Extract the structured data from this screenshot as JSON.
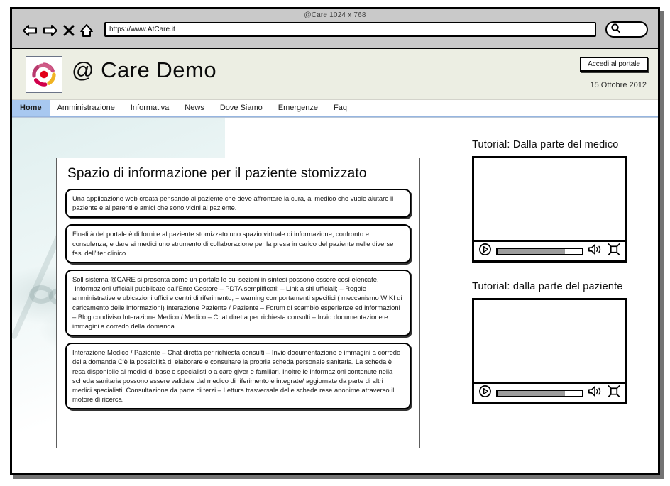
{
  "window": {
    "title": "@Care 1024 x 768"
  },
  "browser": {
    "url": "https://www.AtCare.it",
    "url_placeholder": "https://",
    "back_icon": "back-arrow-icon",
    "forward_icon": "forward-arrow-icon",
    "stop_icon": "stop-x-icon",
    "home_icon": "home-icon",
    "search_icon": "search-icon",
    "search_value": ""
  },
  "site": {
    "title": "@ Care Demo",
    "logo_icon": "at-care-swirl-logo",
    "login_button": "Accedi al portale",
    "date": "15 Ottobre 2012"
  },
  "nav": {
    "items": [
      {
        "label": "Home",
        "active": true
      },
      {
        "label": "Amministrazione",
        "active": false
      },
      {
        "label": "Informativa",
        "active": false
      },
      {
        "label": "News",
        "active": false
      },
      {
        "label": "Dove Siamo",
        "active": false
      },
      {
        "label": "Emergenze",
        "active": false
      },
      {
        "label": "Faq",
        "active": false
      }
    ]
  },
  "article": {
    "heading": "Spazio di informazione per il paziente stomizzato",
    "boxes": [
      "Una applicazione web creata pensando al paziente che deve affrontare la cura, al medico che vuole aiutare il paziente e ai parenti e amici che sono vicini al paziente.",
      "Finalità del portale è di fornire al paziente stomizzato uno spazio virtuale di informazione, confronto e consulenza, e dare ai medici uno strumento di collaborazione per la presa in carico del paziente nelle diverse fasi dell'iter clinico",
      "Soll sistema @CARE si presenta come un portale le cui sezioni in sintesi possono essere così elencate. ·Informazioni ufficiali pubblicate dall'Ente Gestore – PDTA semplificati; – Link a siti ufficiali; – Regole amministrative e ubicazioni uffici e centri di riferimento; – warning comportamenti specifici ( meccanismo WIKI di caricamento delle informazioni) Interazione Paziente / Paziente – Forum di scambio esperienze ed informazioni – Blog condiviso Interazione Medico / Medico – Chat diretta per richiesta consulti – Invio documentazione e immagini a corredo della domanda",
      "Interazione Medico / Paziente – Chat diretta per richiesta consulti – Invio documentazione e immagini a corredo della domanda C'è la possibilità di elaborare e consultare la propria scheda personale sanitaria. La scheda è resa disponibile ai medici di base e specialisti o a care giver e familiari. Inoltre le informazioni contenute nella scheda sanitaria possono essere validate dal medico di riferimento e integrate/ aggiornate da parte di altri medici specialisti. Consultazione da parte di terzi – Lettura trasversale delle schede rese anonime atraverso il motore di ricerca."
    ]
  },
  "tutorials": [
    {
      "title": "Tutorial: Dalla parte del medico",
      "play_icon": "play-circle-icon",
      "volume_icon": "speaker-icon",
      "fullscreen_icon": "fullscreen-icon",
      "progress_percent": 80
    },
    {
      "title": "Tutorial: dalla parte del paziente",
      "play_icon": "play-circle-icon",
      "volume_icon": "speaker-icon",
      "fullscreen_icon": "fullscreen-icon",
      "progress_percent": 80
    }
  ],
  "status_bar": {
    "text": "",
    "resize_icon": "resize-grip-icon"
  },
  "colors": {
    "nav_active": "#a8c8f0",
    "header_bg": "#eceee3",
    "chrome_bg": "#c9c9c9",
    "status_bg": "#bdbdbd"
  }
}
